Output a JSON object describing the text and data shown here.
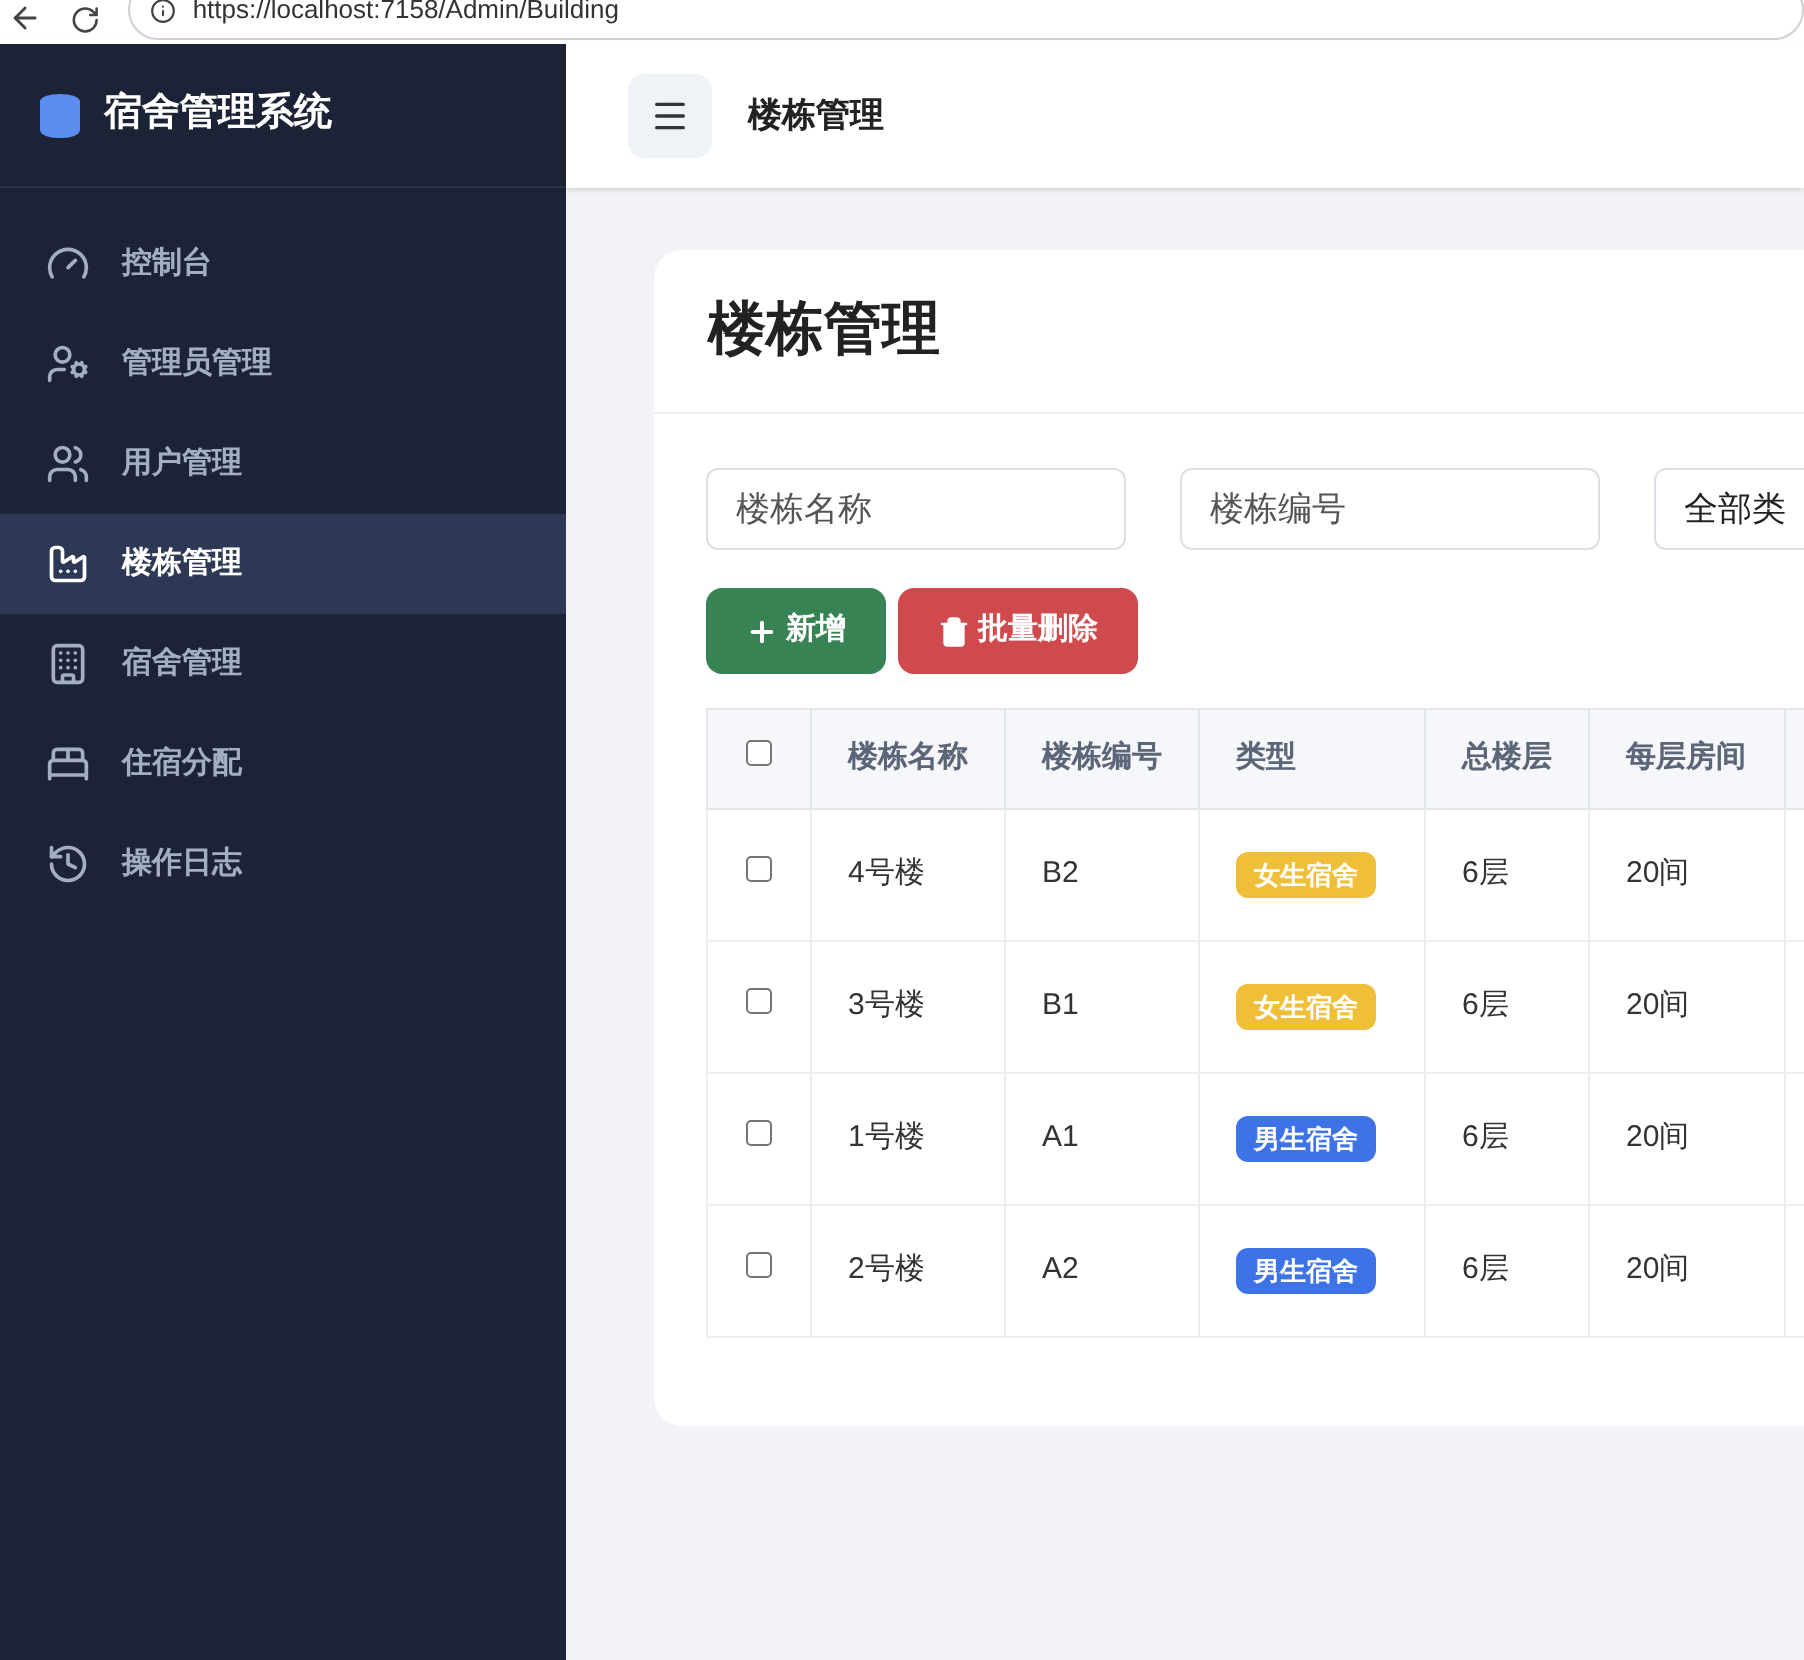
{
  "browser": {
    "url": "https://localhost:7158/Admin/Building"
  },
  "sidebar": {
    "title": "宿舍管理系统",
    "items": [
      {
        "label": "控制台",
        "kind": "dashboard",
        "selected": false
      },
      {
        "label": "管理员管理",
        "kind": "admin",
        "selected": false
      },
      {
        "label": "用户管理",
        "kind": "users",
        "selected": false
      },
      {
        "label": "楼栋管理",
        "kind": "building",
        "selected": true
      },
      {
        "label": "宿舍管理",
        "kind": "dorm",
        "selected": false
      },
      {
        "label": "住宿分配",
        "kind": "bed",
        "selected": false
      },
      {
        "label": "操作日志",
        "kind": "log",
        "selected": false
      }
    ]
  },
  "header": {
    "title": "楼栋管理"
  },
  "page": {
    "title": "楼栋管理",
    "filters": [
      {
        "kind": "input",
        "placeholder": "楼栋名称"
      },
      {
        "kind": "input",
        "placeholder": "楼栋编号"
      },
      {
        "kind": "select",
        "value": "全部类"
      }
    ],
    "buttons": [
      {
        "kind": "add",
        "label": "新增"
      },
      {
        "kind": "delete",
        "label": "批量删除"
      }
    ],
    "table": {
      "select_all": {
        "checked": false
      },
      "columns": [
        "楼栋名称",
        "楼栋编号",
        "类型",
        "总楼层",
        "每层房间"
      ],
      "rows": [
        {
          "checked": false,
          "name": "4号楼",
          "code": "B2",
          "type": {
            "label": "女生宿舍",
            "kind": "female"
          },
          "floors": "6层",
          "rooms": "20间"
        },
        {
          "checked": false,
          "name": "3号楼",
          "code": "B1",
          "type": {
            "label": "女生宿舍",
            "kind": "female"
          },
          "floors": "6层",
          "rooms": "20间"
        },
        {
          "checked": false,
          "name": "1号楼",
          "code": "A1",
          "type": {
            "label": "男生宿舍",
            "kind": "male"
          },
          "floors": "6层",
          "rooms": "20间"
        },
        {
          "checked": false,
          "name": "2号楼",
          "code": "A2",
          "type": {
            "label": "男生宿舍",
            "kind": "male"
          },
          "floors": "6层",
          "rooms": "20间"
        }
      ]
    }
  }
}
